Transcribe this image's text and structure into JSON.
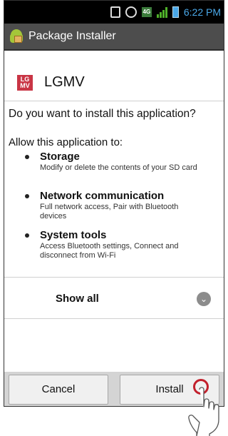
{
  "status_bar": {
    "time": "6:22 PM",
    "network_badge": "4G",
    "icons": [
      "sim-icon",
      "alarm-icon",
      "4g-icon",
      "signal-icon",
      "battery-icon"
    ]
  },
  "title_bar": {
    "title": "Package Installer",
    "icon": "android-package-icon"
  },
  "app": {
    "icon_text_top": "LG",
    "icon_text_bottom": "MV",
    "name": "LGMV"
  },
  "prompt": {
    "question": "Do you want to install this application?",
    "allow_heading": "Allow this application to:"
  },
  "permissions": [
    {
      "title": "Storage",
      "description": "Modify or delete the contents of your SD card"
    },
    {
      "title": "Network communication",
      "description": "Full network access, Pair with Bluetooth devices"
    },
    {
      "title": "System tools",
      "description": "Access Bluetooth settings, Connect and disconnect from Wi-Fi"
    }
  ],
  "show_all": {
    "label": "Show all",
    "icon": "chevron-down-icon"
  },
  "buttons": {
    "cancel": "Cancel",
    "install": "Install"
  },
  "colors": {
    "accent": "#4aa8e8",
    "title_bar": "#4d4d4d",
    "tap_indicator": "#c2202c",
    "app_icon": "#c93545"
  }
}
